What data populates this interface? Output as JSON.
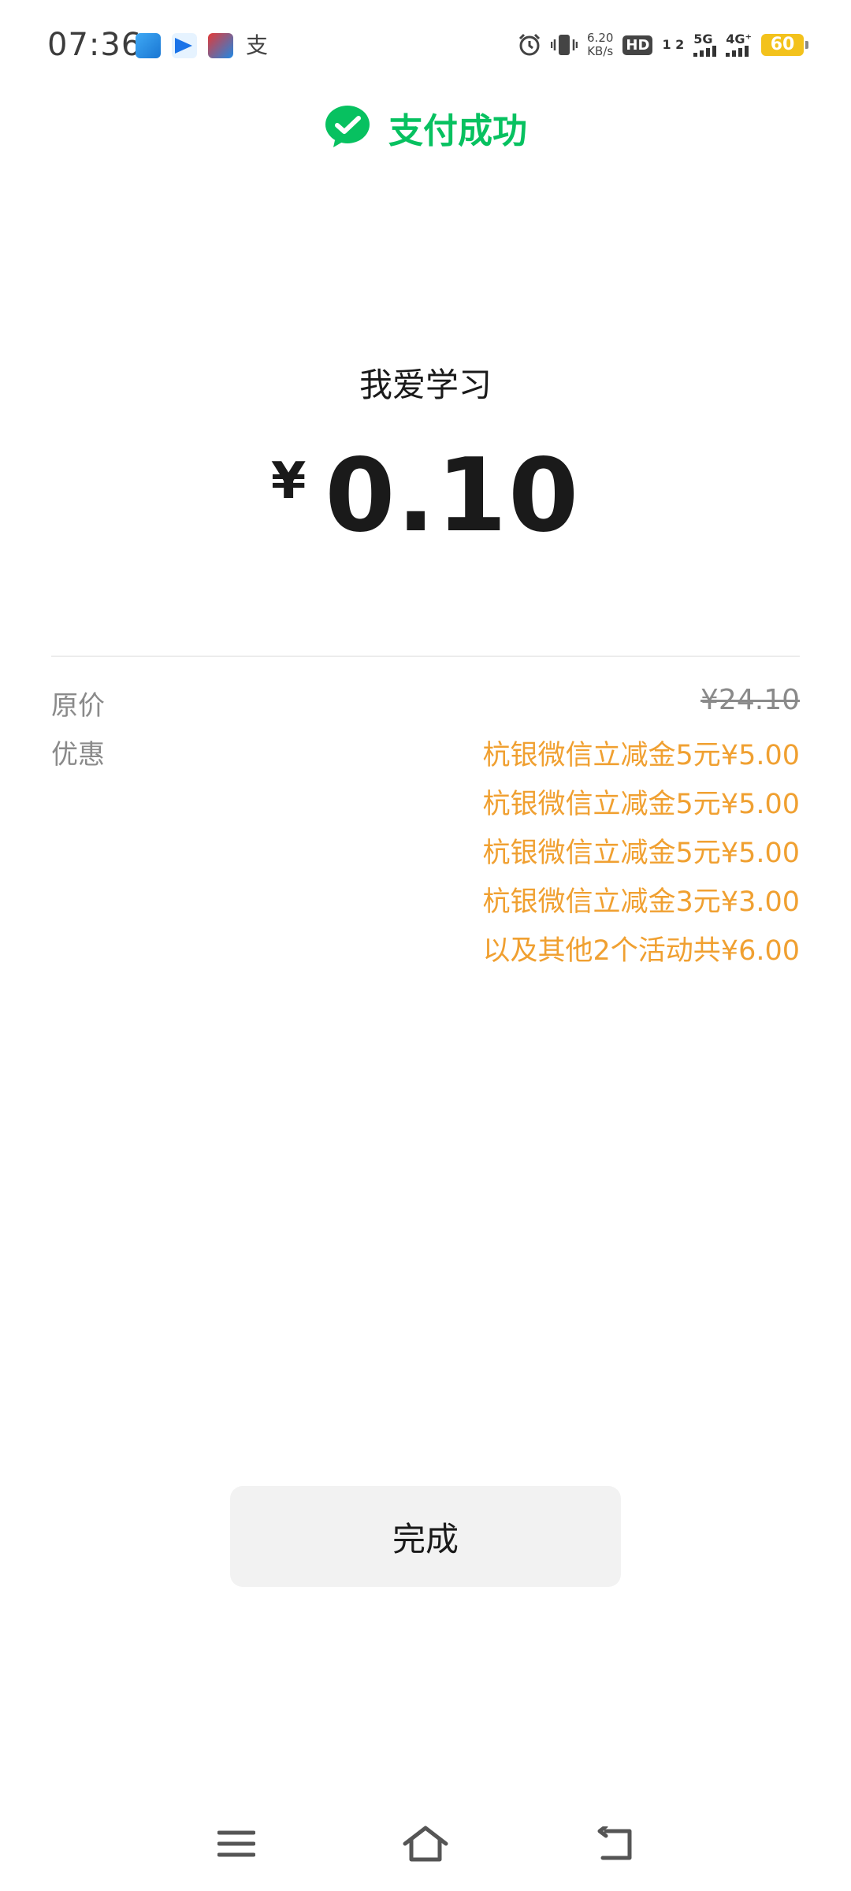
{
  "status_bar": {
    "time": "07:36",
    "notification_icons": [
      "app-icon-blue",
      "paper-plane-icon",
      "game-icon",
      "alipay-icon"
    ],
    "alipay_glyph": "支",
    "net_speed_value": "6.20",
    "net_speed_unit": "KB/s",
    "hd_label": "HD",
    "sim_slots": "1 2",
    "sig1_label": "5G",
    "sig2_label": "4G⁺",
    "battery_level": "60",
    "battery_color": "#f3c21c"
  },
  "header": {
    "title": "支付成功",
    "accent_color": "#07c160"
  },
  "payment": {
    "merchant": "我爱学习",
    "currency_symbol": "¥",
    "amount": "0.10"
  },
  "breakdown": {
    "original_label": "原价",
    "original_price": "¥24.10",
    "discount_label": "优惠",
    "discount_color": "#f0a031",
    "discounts": [
      "杭银微信立减金5元¥5.00",
      "杭银微信立减金5元¥5.00",
      "杭银微信立减金5元¥5.00",
      "杭银微信立减金3元¥3.00",
      "以及其他2个活动共¥6.00"
    ]
  },
  "actions": {
    "done_label": "完成"
  },
  "nav": {
    "menu_icon": "menu-icon",
    "home_icon": "home-icon",
    "back_icon": "back-icon"
  }
}
